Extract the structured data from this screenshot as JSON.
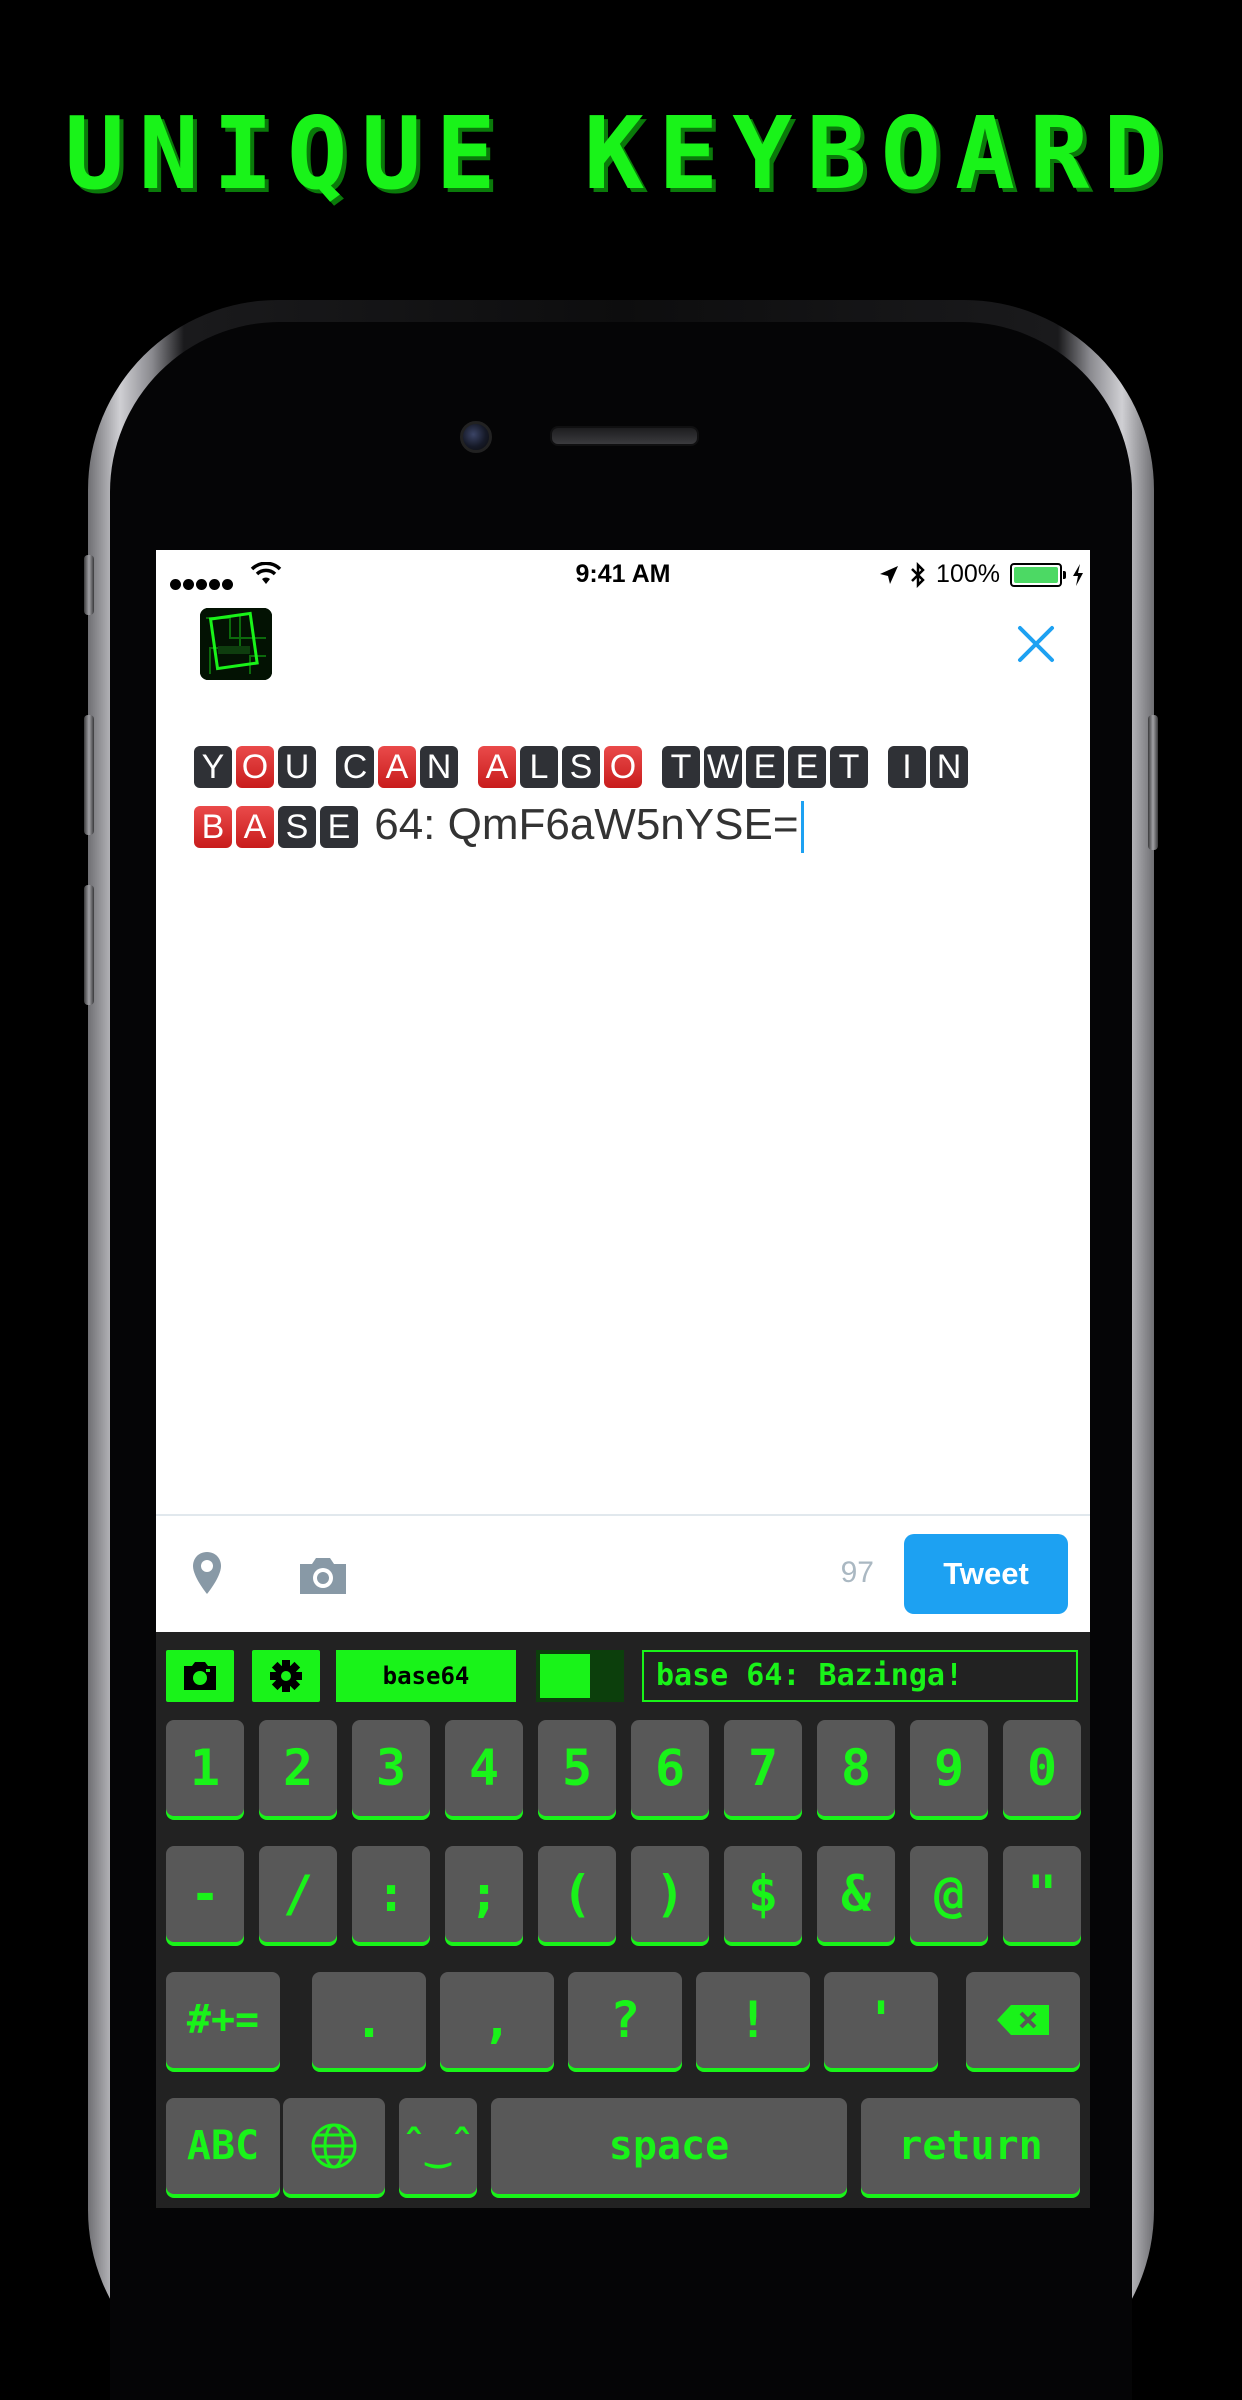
{
  "headline": "UNIQUE KEYBOARD",
  "statusbar": {
    "time": "9:41 AM",
    "battery": "100%"
  },
  "compose": {
    "line1_words": [
      [
        {
          "c": "Y",
          "t": "dark"
        },
        {
          "c": "O",
          "t": "red"
        },
        {
          "c": "U",
          "t": "dark"
        }
      ],
      [
        {
          "c": "C",
          "t": "dark"
        },
        {
          "c": "A",
          "t": "red"
        },
        {
          "c": "N",
          "t": "dark"
        }
      ],
      [
        {
          "c": "A",
          "t": "red"
        },
        {
          "c": "L",
          "t": "dark"
        },
        {
          "c": "S",
          "t": "dark"
        },
        {
          "c": "O",
          "t": "red"
        }
      ],
      [
        {
          "c": "T",
          "t": "dark"
        },
        {
          "c": "W",
          "t": "dark"
        },
        {
          "c": "E",
          "t": "dark"
        },
        {
          "c": "E",
          "t": "dark"
        },
        {
          "c": "T",
          "t": "dark"
        }
      ],
      [
        {
          "c": "I",
          "t": "dark"
        },
        {
          "c": "N",
          "t": "dark"
        }
      ]
    ],
    "line2_tiles": [
      {
        "c": "B",
        "t": "red"
      },
      {
        "c": "A",
        "t": "red"
      },
      {
        "c": "S",
        "t": "dark"
      },
      {
        "c": "E",
        "t": "dark"
      }
    ],
    "line2_text": " 64: QmF6aW5nYSE="
  },
  "footer": {
    "char_count": "97",
    "tweet_label": "Tweet"
  },
  "keyboard": {
    "mode_label": "base64",
    "preview_text": "base 64: Bazinga!",
    "row1": [
      "1",
      "2",
      "3",
      "4",
      "5",
      "6",
      "7",
      "8",
      "9",
      "0"
    ],
    "row2": [
      "-",
      "/",
      ":",
      ";",
      "(",
      ")",
      "$",
      "&",
      "@",
      "\""
    ],
    "row3": {
      "shift": "#+=",
      "keys": [
        ".",
        ",",
        "?",
        "!",
        "'"
      ]
    },
    "row4": {
      "abc": "ABC",
      "emoji": "ˆ‿ˆ",
      "space": "space",
      "return": "return"
    }
  },
  "colors": {
    "accent_green": "#19f319",
    "twitter_blue": "#1da1f2",
    "key_gray": "#585858"
  }
}
